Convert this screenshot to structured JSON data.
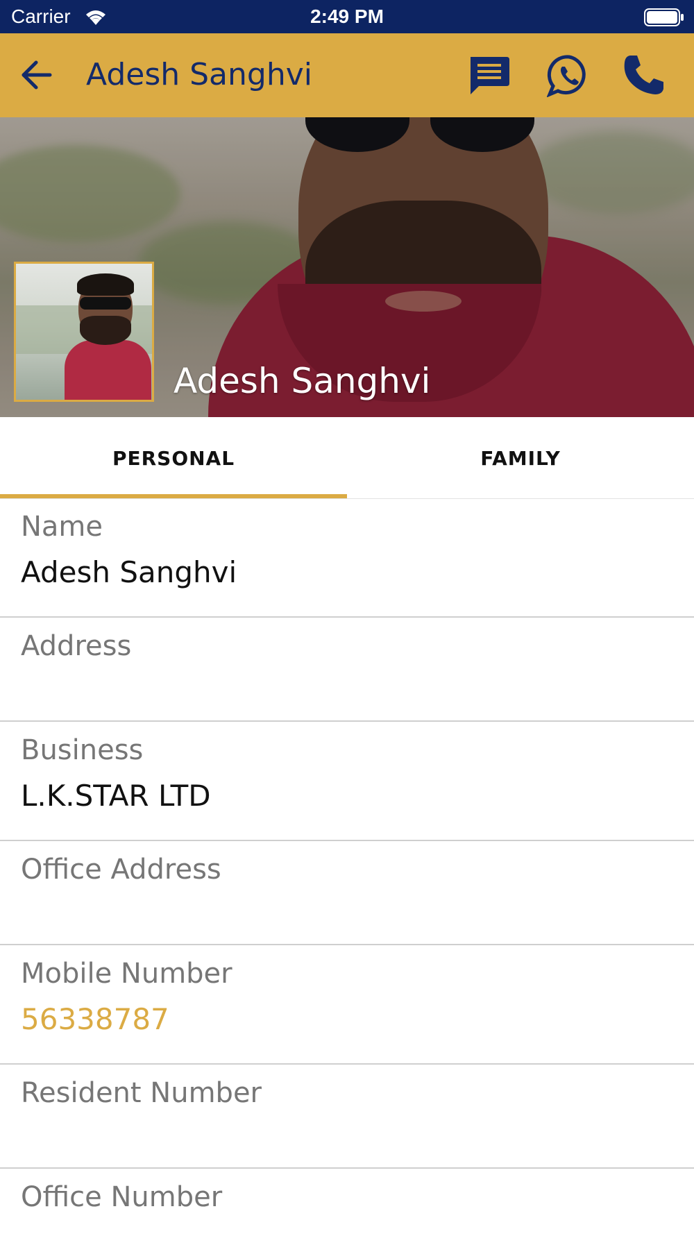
{
  "status_bar": {
    "carrier": "Carrier",
    "time": "2:49 PM"
  },
  "app_bar": {
    "title": "Adesh Sanghvi",
    "icons": [
      "back-icon",
      "message-icon",
      "whatsapp-icon",
      "phone-icon"
    ]
  },
  "profile": {
    "name": "Adesh Sanghvi"
  },
  "tabs": [
    {
      "label": "PERSONAL",
      "selected": true
    },
    {
      "label": "FAMILY",
      "selected": false
    }
  ],
  "fields": {
    "name": {
      "label": "Name",
      "value": "Adesh Sanghvi"
    },
    "address": {
      "label": "Address",
      "value": ""
    },
    "business": {
      "label": "Business",
      "value": "L.K.STAR LTD"
    },
    "office_address": {
      "label": "Office Address",
      "value": ""
    },
    "mobile_number": {
      "label": "Mobile Number",
      "value": "56338787"
    },
    "resident_number": {
      "label": "Resident Number",
      "value": ""
    },
    "office_number": {
      "label": "Office Number",
      "value": ""
    }
  },
  "colors": {
    "status_bar": "#0d2462",
    "accent": "#dbab44",
    "icon": "#132a6a"
  }
}
